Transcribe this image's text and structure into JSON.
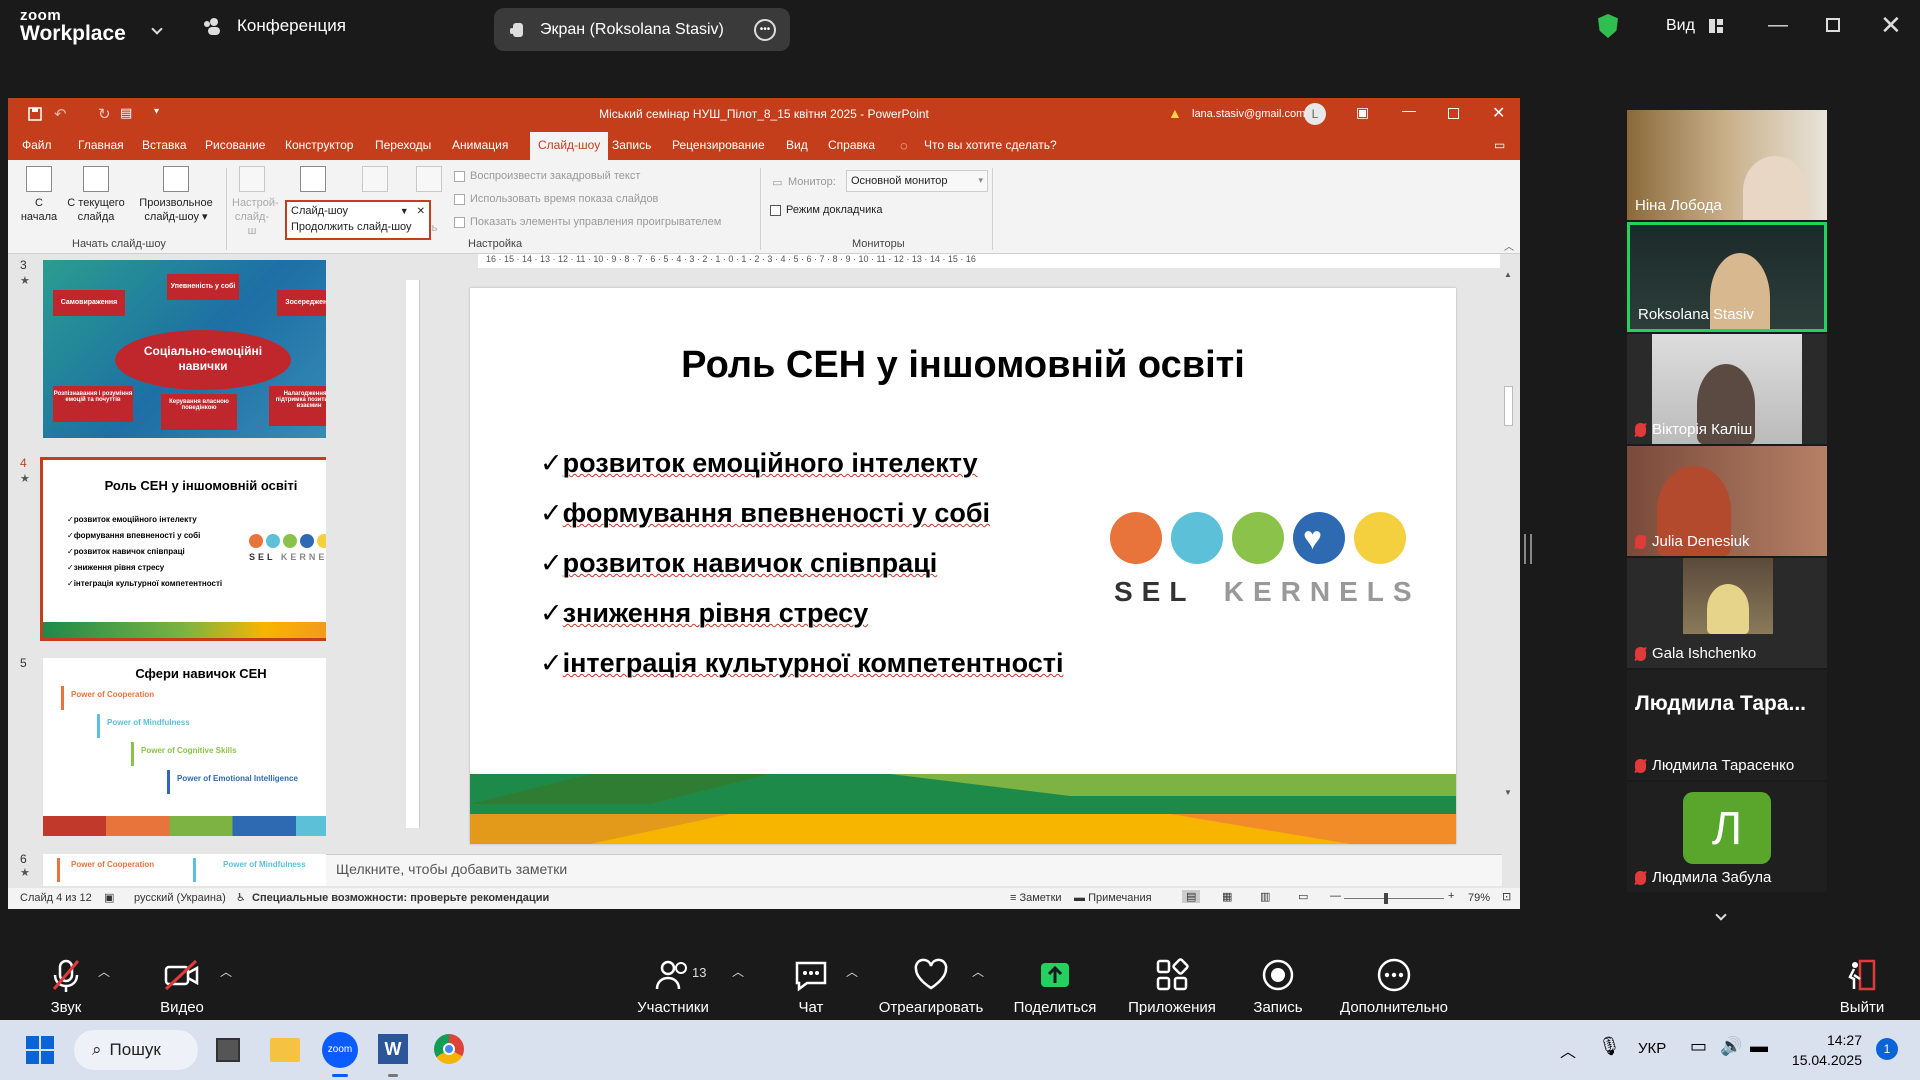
{
  "zoom": {
    "brand_top": "zoom",
    "brand_bottom": "Workplace",
    "meeting_label": "Конференция",
    "share_label": "Экран (Roksolana Stasiv)",
    "view_label": "Вид",
    "toolbar": {
      "audio": "Звук",
      "video": "Видео",
      "participants": "Участники",
      "participants_count": "13",
      "chat": "Чат",
      "react": "Отреагировать",
      "share": "Поделиться",
      "apps": "Приложения",
      "record": "Запись",
      "more": "Дополнительно",
      "leave": "Выйти"
    },
    "participants": [
      {
        "name": "Ніна Лобода"
      },
      {
        "name": "Roksolana Stasiv"
      },
      {
        "name": "Вікторія Каліш"
      },
      {
        "name": "Julia Denesiuk"
      },
      {
        "name": "Gala Ishchenko"
      },
      {
        "name": "Людмила Тара...",
        "sub": "Людмила Тарасенко"
      },
      {
        "name": "Людмила Забула",
        "initial": "Л"
      }
    ]
  },
  "ppt": {
    "window_title": "Міський семінар НУШ_Пілот_8_15 квітня 2025  -  PowerPoint",
    "account": "lana.stasiv@gmail.com",
    "avatar_letter": "L",
    "tabs": [
      "Файл",
      "Главная",
      "Вставка",
      "Рисование",
      "Конструктор",
      "Переходы",
      "Анимация",
      "Слайд-шоу",
      "Запись",
      "Рецензирование",
      "Вид",
      "Справка"
    ],
    "active_tab": "Слайд-шоу",
    "tell_me": "Что вы хотите сделать?",
    "ribbon": {
      "from_start_1": "С",
      "from_start_2": "начала",
      "from_current_1": "С текущего",
      "from_current_2": "слайда",
      "custom_1": "Произвольное",
      "custom_2": "слайд-шоу",
      "group_start": "Начать слайд-шоу",
      "setup_1": "Настрой-",
      "setup_2": "слайд-ш",
      "dropdown_value": "Слайд-шоу",
      "dropdown_option": "Продолжить слайд-шоу",
      "rehearse_tail": "ись",
      "chk_narration": "Воспроизвести закадровый текст",
      "chk_timings": "Использовать время показа слайдов",
      "chk_controls": "Показать элементы управления проигрывателем",
      "group_setup": "Настройка",
      "monitor_label": "Монитор:",
      "monitor_value": "Основной монитор",
      "presenter_view": "Режим докладчика",
      "group_monitors": "Мониторы"
    },
    "thumbs": {
      "slide3": {
        "num": "3",
        "center": "Соціально-емоційні навички",
        "b1": "Самовираження",
        "b2": "Упевненість у собі",
        "b3": "Зосередженість",
        "b4": "Розпізнавання і розуміння емоцій та почуттів",
        "b5": "Керування власною поведінкою",
        "b6": "Налагодження та підтримка позитивних взаємин"
      },
      "slide4": {
        "num": "4",
        "title": "Роль СЕН у іншомовній освіті",
        "items": [
          "розвиток емоційного інтелекту",
          "формування впевненості у собі",
          "розвиток навичок співпраці",
          "зниження рівня стресу",
          "інтеграція культурної компетентності"
        ]
      },
      "slide5": {
        "num": "5",
        "title": "Сфери навичок СЕН",
        "items": [
          "Power of Cooperation",
          "Power of Mindfulness",
          "Power of Cognitive Skills",
          "Power of Emotional Intelligence"
        ]
      },
      "slide6": {
        "num": "6",
        "items": [
          "Power of Cooperation",
          "Power of Mindfulness"
        ]
      }
    },
    "slide": {
      "title": "Роль СЕН у іншомовній освіті",
      "items": [
        "розвиток емоційного інтелекту",
        "формування впевненості у собі",
        "розвиток навичок співпраці",
        "зниження рівня стресу",
        "інтеграція культурної компетентності"
      ],
      "logo_left": "SEL",
      "logo_right": "KERNELS"
    },
    "ruler_h": "16 · 15 · 14 · 13 · 12 · 11 · 10 · 9 · 8 · 7 · 6 · 5 · 4 · 3 · 2 · 1 · 0 · 1 · 2 · 3 · 4 · 5 · 6 · 7 · 8 · 9 · 10 · 11 · 12 · 13 · 14 · 15 · 16",
    "notes_placeholder": "Щелкните, чтобы добавить заметки",
    "status": {
      "slide_info": "Слайд 4 из 12",
      "language": "русский (Украина)",
      "accessibility": "Специальные возможности: проверьте рекомендации",
      "notes": "Заметки",
      "comments": "Примечания",
      "zoom": "79%"
    }
  },
  "taskbar": {
    "search": "Пошук",
    "lang": "УКР",
    "time": "14:27",
    "date": "15.04.2025",
    "badge": "1"
  },
  "colors": {
    "ppt_accent": "#c43e1c",
    "zoom_bg": "#1a1a1a",
    "active_speaker": "#23d160"
  }
}
